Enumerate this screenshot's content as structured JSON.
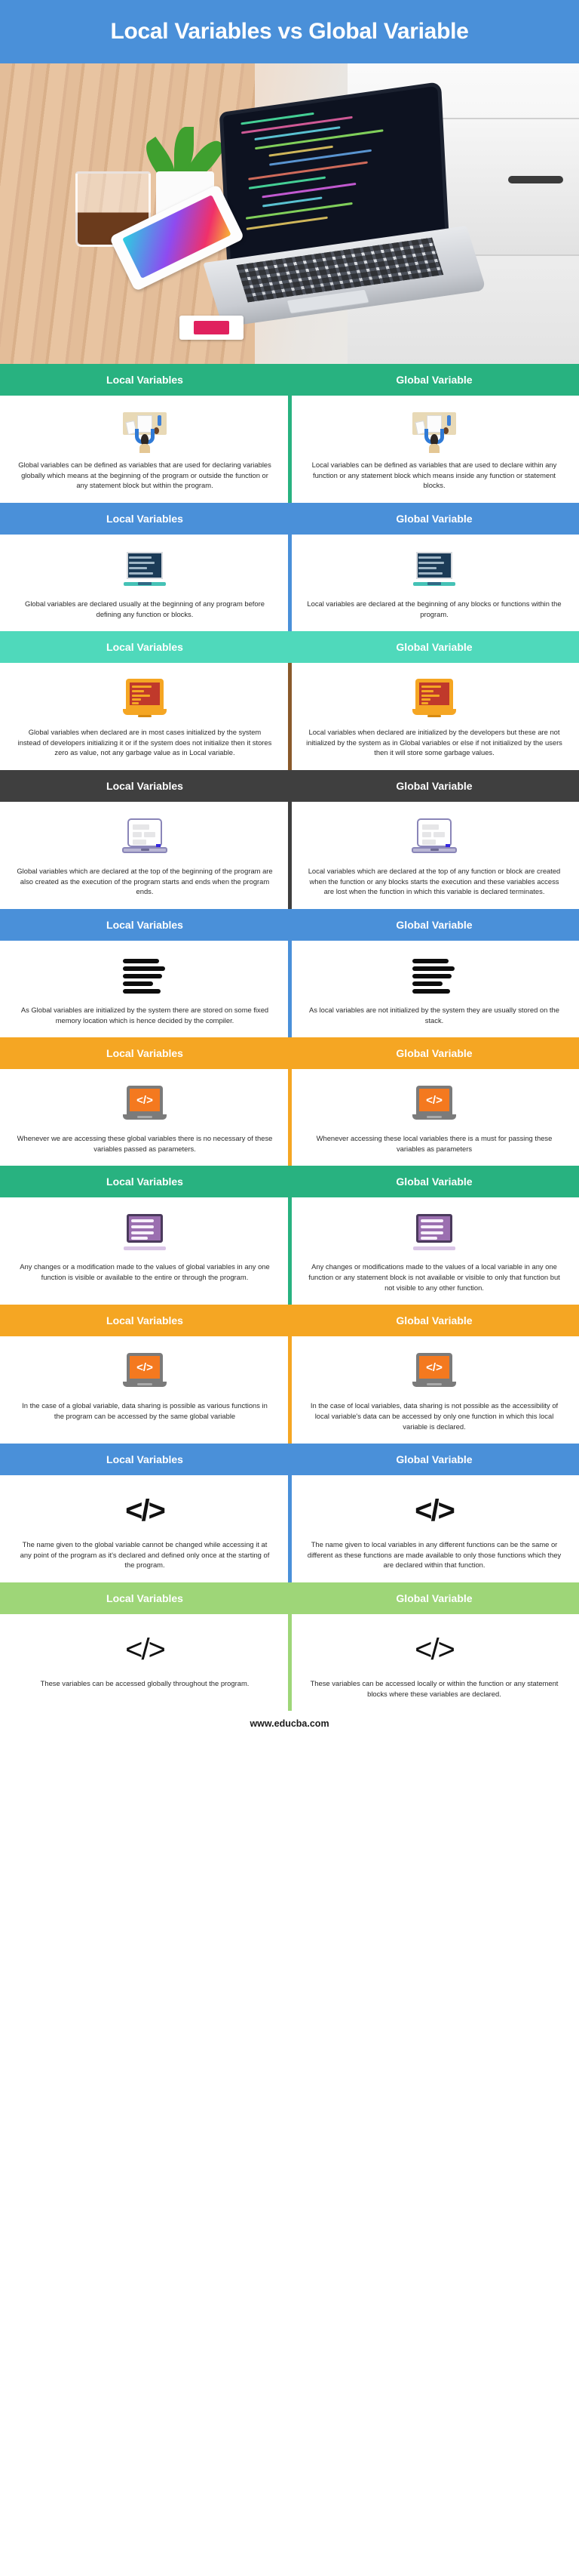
{
  "header": {
    "title": "Local Variables vs Global Variable",
    "title_bg": "#4a90d9"
  },
  "hero": {
    "alt": "laptop-on-desk-photo"
  },
  "column_labels": {
    "left": "Local Variables",
    "right": "Global Variable"
  },
  "footer": {
    "site": "www.educba.com"
  },
  "rows": [
    {
      "band_color": "#28b280",
      "divider_color": "#28b280",
      "icon": "desk-worker-icon",
      "left_text": "Global variables can be defined as variables that are used for declaring variables globally which means at the beginning of the program or outside the function or any statement block but within the program.",
      "right_text": "Local variables can be defined as variables that are used to declare within any function or any statement block which means inside any function or statement blocks."
    },
    {
      "band_color": "#4a90d9",
      "divider_color": "#4a90d9",
      "icon": "dark-monitor-icon",
      "left_text": "Global variables are declared usually at the beginning of any program before defining any function or blocks.",
      "right_text": "Local variables are declared at the beginning of any blocks or functions within the program."
    },
    {
      "band_color": "#4fd9bb",
      "divider_color": "#8a5a2b",
      "icon": "orange-laptop-icon",
      "left_text": "Global variables when declared are in most cases initialized by the system instead of developers initializing it or if the system does not initialize then it stores zero as value, not any garbage value as in Local variable.",
      "right_text": "Local variables when declared are initialized by the developers but these are not initialized by the system as in Global variables or else if not initialized by the users then it will store some garbage values."
    },
    {
      "band_color": "#3f3f3f",
      "divider_color": "#3f3f3f",
      "icon": "purple-laptop-icon",
      "left_text": "Global variables which are declared at the top of the beginning of the program are also created as the execution of the program starts and ends when the program ends.",
      "right_text": "Local variables which are declared at the top of any function or block are created when the function or any blocks starts the execution and these variables access are lost when the function in which this variable is declared terminates."
    },
    {
      "band_color": "#4a90d9",
      "divider_color": "#4a90d9",
      "icon": "black-lines-icon",
      "left_text": "As Global variables are initialized by the system there are stored on some fixed memory location which is hence decided by the compiler.",
      "right_text": "As local variables are not initialized by the system they are usually stored on the stack."
    },
    {
      "band_color": "#f5a623",
      "divider_color": "#f5a623",
      "icon": "orange-code-laptop-icon",
      "left_text": "Whenever we are accessing these global variables there is no necessary of these variables passed as parameters.",
      "right_text": "Whenever accessing these local variables there is a must for passing these variables as parameters"
    },
    {
      "band_color": "#28b280",
      "divider_color": "#28b280",
      "icon": "purple-monitor-icon",
      "left_text": "Any changes or a modification made to the values of global variables in any one function is visible or available to the entire or through the program.",
      "right_text": "Any changes or modifications made to the values of a local variable in any one function or any statement block is not available or visible to only that function but not visible to any other function."
    },
    {
      "band_color": "#f5a623",
      "divider_color": "#f5a623",
      "icon": "orange-code-laptop-icon",
      "left_text": "In the case of a global variable, data sharing is possible as various functions in the program can be accessed by the same global variable",
      "right_text": "In the case of local variables, data sharing is not possible as the accessibility of local variable's data can be accessed by only one function in which this local variable is declared."
    },
    {
      "band_color": "#4a90d9",
      "divider_color": "#4a90d9",
      "icon": "big-code-glyph-icon",
      "icon_glyph": "</>",
      "left_text": "The name given to the global variable cannot be changed while accessing it at any point of the program as it's declared and defined only once at the starting of the program.",
      "right_text": "The name given to local variables in any different functions can be the same or different as these functions are made available to only those functions which they are declared within that function."
    },
    {
      "band_color": "#9ed678",
      "divider_color": "#9ed678",
      "icon": "big-code-glyph-icon",
      "icon_glyph": "</>",
      "left_text": "These variables can be accessed globally throughout the program.",
      "right_text": "These variables can be accessed locally or within the function or any statement blocks where these variables are declared."
    }
  ]
}
